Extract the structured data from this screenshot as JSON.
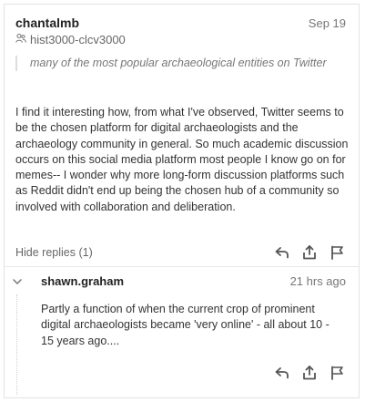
{
  "post": {
    "author": "chantalmb",
    "date": "Sep 19",
    "group": "hist3000-clcv3000",
    "quote": "many of the most popular archaeological entities on Twitter",
    "body": "I find it interesting how, from what I've observed, Twitter seems to be the chosen platform for digital archaeologists and the archaeology community in general. So much academic discussion occurs on this social media platform most people I know go on for memes-- I wonder why more long-form discussion platforms such as Reddit didn't end up being the chosen hub of a community so involved with collaboration and deliberation.",
    "hide_replies_label": "Hide replies (1)"
  },
  "reply": {
    "author": "shawn.graham",
    "date": "21 hrs ago",
    "body": "Partly a function of when the current crop of prominent digital archaeologists became 'very online' - all about 10 - 15 years ago...."
  },
  "icons": {
    "group": "group-icon",
    "reply": "reply-icon",
    "share": "share-icon",
    "flag": "flag-icon",
    "collapse": "chevron-down-icon"
  },
  "colors": {
    "text": "#333333",
    "muted": "#777777",
    "border": "#e3e3e3",
    "icon": "#555555"
  }
}
